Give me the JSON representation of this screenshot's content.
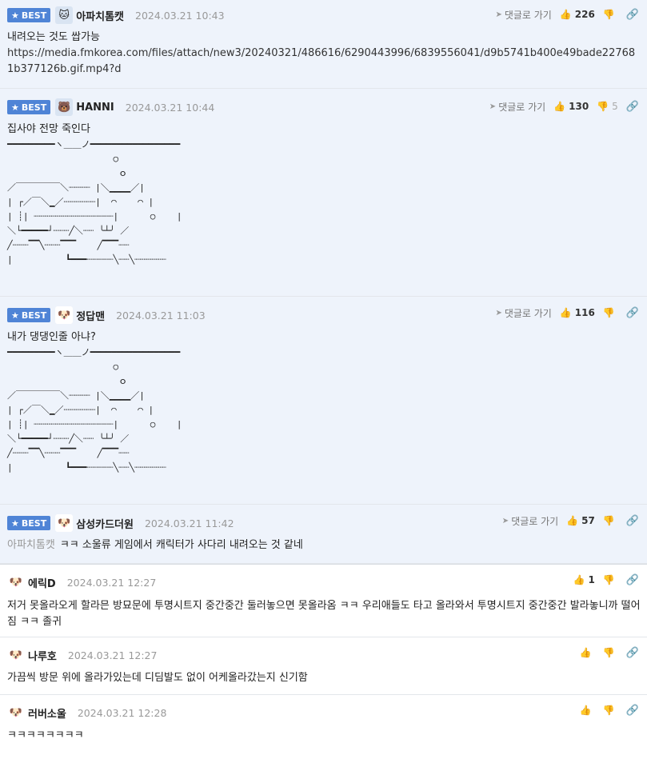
{
  "ui": {
    "best_label": "BEST",
    "reply_label": "댓글로 가기"
  },
  "comments": [
    {
      "nick": "아파치톰캣",
      "date": "2024.03.21 10:43",
      "likes": "226",
      "dislikes": "",
      "text": "내려오는 것도 쌉가능",
      "url": "https://media.fmkorea.com/files/attach/new3/20240321/486616/6290443996/6839556041/d9b5741b400e49bade227681b377126b.gif.mp4?d"
    },
    {
      "nick": "HANNI",
      "date": "2024.03.21 10:44",
      "likes": "130",
      "dislikes": "5",
      "text": "집사야 전망 죽인다",
      "ascii": "━━━━━━━━━ヽ＿＿ノ━━━━━━━━━━━━━━━━━\n                    ○\n                     ｏ\n／￣￣￣￣￣＼┈┈┈┈ |＼▁▁▁▁／|\n| ┌／￣＼▁／┈┈┈┈┈┈|  ◠    ◠ |\n| ┊| ┈┈┈┈┈┈┈┈┈┈┈┈┈┈┈|      ○    |\n＼└━━━━━┘┈┈┈╱＼┈┈ ╰┴╯ ／\n╱┈┈┈▔▔╲┈┈┈▔▔▔    ╱▔▔▔┈┈\n|          ┗━━━┈┈┈┈┈╲┈┈╲┈┈┈┈┈┈"
    },
    {
      "nick": "정답맨",
      "date": "2024.03.21 11:03",
      "likes": "116",
      "dislikes": "",
      "text": "내가 댕댕인줄 아냐?",
      "ascii": "━━━━━━━━━ヽ＿＿ノ━━━━━━━━━━━━━━━━━\n                    ○\n                     ｏ\n／￣￣￣￣￣＼┈┈┈┈ |＼▁▁▁▁／|\n| ┌／￣＼▁／┈┈┈┈┈┈|  ◠    ◠ |\n| ┊| ┈┈┈┈┈┈┈┈┈┈┈┈┈┈┈|      ○    |\n＼└━━━━━┘┈┈┈╱＼┈┈ ╰┴╯ ／\n╱┈┈┈▔▔╲┈┈┈▔▔▔    ╱▔▔▔┈┈\n|          ┗━━━┈┈┈┈┈╲┈┈╲┈┈┈┈┈┈"
    },
    {
      "nick": "삼성카드더원",
      "date": "2024.03.21 11:42",
      "likes": "57",
      "dislikes": "",
      "mention": "아파치톰캣",
      "text": "ㅋㅋ 소울류 게임에서 캐릭터가 사다리 내려오는 것 같네"
    },
    {
      "nick": "에릭D",
      "date": "2024.03.21 12:27",
      "likes": "1",
      "dislikes": "",
      "text": "저거 못올라오게 할라믄 방묘문에 투명시트지 중간중간 둘러놓으면 못올라옴 ㅋㅋ 우리애들도 타고 올라와서 투명시트지 중간중간 발라놓니까 떨어짐 ㅋㅋ 졸귀"
    },
    {
      "nick": "나루호",
      "date": "2024.03.21 12:27",
      "likes": "",
      "dislikes": "",
      "text": "가끔씩 방문 위에 올라가있는데 디딤발도 없이 어케올라갔는지 신기함"
    },
    {
      "nick": "러버소울",
      "date": "2024.03.21 12:28",
      "likes": "",
      "dislikes": "",
      "text": "ㅋㅋㅋㅋㅋㅋㅋㅋ"
    }
  ]
}
